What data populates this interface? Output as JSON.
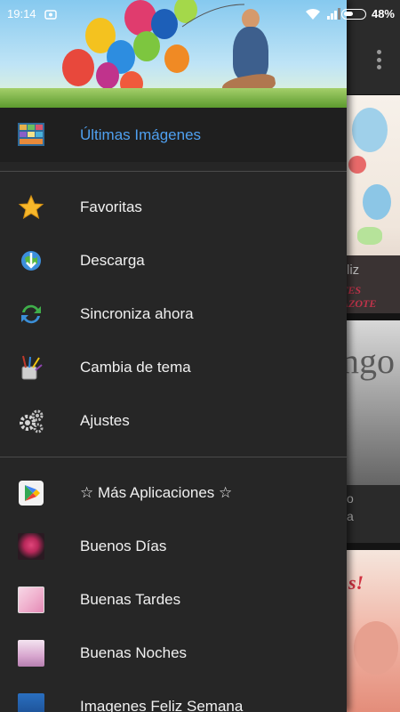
{
  "status_bar": {
    "time": "19:14",
    "battery_percent_label": "48%",
    "battery_level": 0.48
  },
  "drawer": {
    "active_item": {
      "label": "Últimas Imágenes",
      "icon": "collage-thumbnail-icon"
    },
    "items": [
      {
        "label": "Favoritas",
        "icon": "star-icon"
      },
      {
        "label": "Descarga",
        "icon": "download-globe-icon"
      },
      {
        "label": "Sincroniza ahora",
        "icon": "sync-icon"
      },
      {
        "label": "Cambia de tema",
        "icon": "paint-brushes-icon"
      },
      {
        "label": "Ajustes",
        "icon": "gears-icon"
      }
    ],
    "apps": [
      {
        "label": "☆ Más Aplicaciones ☆",
        "icon": "play-store-icon"
      },
      {
        "label": "Buenos Días",
        "icon": "buenos-dias-app-icon"
      },
      {
        "label": "Buenas Tardes",
        "icon": "buenas-tardes-app-icon"
      },
      {
        "label": "Buenas Noches",
        "icon": "buenas-noches-app-icon"
      },
      {
        "label": "Imagenes Feliz Semana",
        "icon": "feliz-semana-app-icon"
      }
    ]
  },
  "background_cards": {
    "card1_text1": "liz",
    "card1_text2": "TES\nAZOTE",
    "card2_big": "ngo",
    "card2_text1": "o",
    "card2_text2": "a",
    "card3_text": "s!"
  },
  "colors": {
    "drawer_bg": "#262626",
    "active_label": "#4fa0f0",
    "label": "#f0f0f0"
  }
}
